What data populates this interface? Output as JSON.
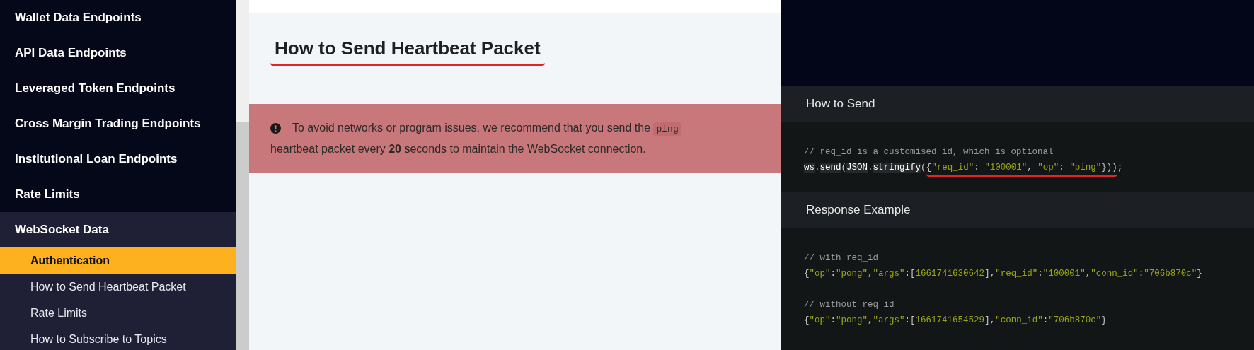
{
  "sidebar": {
    "items": [
      {
        "label": "Wallet Data Endpoints",
        "expanded": false
      },
      {
        "label": "API Data Endpoints",
        "expanded": false
      },
      {
        "label": "Leveraged Token Endpoints",
        "expanded": false
      },
      {
        "label": "Cross Margin Trading Endpoints",
        "expanded": false
      },
      {
        "label": "Institutional Loan Endpoints",
        "expanded": false
      },
      {
        "label": "Rate Limits",
        "expanded": false
      },
      {
        "label": "WebSocket Data",
        "expanded": true,
        "children": [
          {
            "label": "Authentication",
            "selected": true
          },
          {
            "label": "How to Send Heartbeat Packet",
            "selected": false
          },
          {
            "label": "Rate Limits",
            "selected": false
          },
          {
            "label": "How to Subscribe to Topics",
            "selected": false
          }
        ]
      }
    ]
  },
  "main": {
    "heading": {
      "text": "How to Send Heartbeat Packet",
      "underlined": true
    },
    "alert": {
      "before": "To avoid networks or program issues, we recommend that you send the",
      "code": "ping",
      "after": "heartbeat packet every **20** seconds to maintain the WebSocket connection."
    }
  },
  "code_panel": {
    "sections": [
      {
        "title": "How to Send",
        "blocks": [
          [
            [
              {
                "text": "// req_id is a customised id, which is optional",
                "kind": "comment"
              }
            ],
            [
              {
                "text": "ws",
                "kind": "ident"
              },
              {
                "text": ".",
                "kind": "plain"
              },
              {
                "text": "send",
                "kind": "ident"
              },
              {
                "text": "(",
                "kind": "plain"
              },
              {
                "text": "JSON",
                "kind": "ident"
              },
              {
                "text": ".",
                "kind": "plain"
              },
              {
                "text": "stringify",
                "kind": "ident"
              },
              {
                "text": "(",
                "kind": "plain"
              },
              {
                "kind": "group",
                "underlined": true,
                "tokens": [
                  {
                    "text": "{",
                    "kind": "plain"
                  },
                  {
                    "text": "\"req_id\"",
                    "kind": "string"
                  },
                  {
                    "text": ": ",
                    "kind": "plain"
                  },
                  {
                    "text": "\"100001\"",
                    "kind": "string"
                  },
                  {
                    "text": ", ",
                    "kind": "plain"
                  },
                  {
                    "text": "\"op\"",
                    "kind": "string"
                  },
                  {
                    "text": ": ",
                    "kind": "plain"
                  },
                  {
                    "text": "\"ping\"",
                    "kind": "string"
                  },
                  {
                    "text": "}))",
                    "kind": "plain"
                  }
                ]
              },
              {
                "text": ";",
                "kind": "plain"
              }
            ]
          ]
        ]
      },
      {
        "title": "Response Example",
        "blocks": [
          [
            [
              {
                "text": "// with req_id",
                "kind": "comment"
              }
            ],
            [
              {
                "text": "{",
                "kind": "plain"
              },
              {
                "text": "\"op\"",
                "kind": "string"
              },
              {
                "text": ":",
                "kind": "plain"
              },
              {
                "text": "\"pong\"",
                "kind": "string"
              },
              {
                "text": ",",
                "kind": "plain"
              },
              {
                "text": "\"args\"",
                "kind": "string"
              },
              {
                "text": ":[",
                "kind": "plain"
              },
              {
                "text": "1661741630642",
                "kind": "string"
              },
              {
                "text": "],",
                "kind": "plain"
              },
              {
                "text": "\"req_id\"",
                "kind": "string"
              },
              {
                "text": ":",
                "kind": "plain"
              },
              {
                "text": "\"100001\"",
                "kind": "string"
              },
              {
                "text": ",",
                "kind": "plain"
              },
              {
                "text": "\"conn_id\"",
                "kind": "string"
              },
              {
                "text": ":",
                "kind": "plain"
              },
              {
                "text": "\"706b870c\"",
                "kind": "string"
              },
              {
                "text": "}",
                "kind": "plain"
              }
            ]
          ],
          [
            [
              {
                "text": "// without req_id",
                "kind": "comment"
              }
            ],
            [
              {
                "text": "{",
                "kind": "plain"
              },
              {
                "text": "\"op\"",
                "kind": "string"
              },
              {
                "text": ":",
                "kind": "plain"
              },
              {
                "text": "\"pong\"",
                "kind": "string"
              },
              {
                "text": ",",
                "kind": "plain"
              },
              {
                "text": "\"args\"",
                "kind": "string"
              },
              {
                "text": ":[",
                "kind": "plain"
              },
              {
                "text": "1661741654529",
                "kind": "string"
              },
              {
                "text": "],",
                "kind": "plain"
              },
              {
                "text": "\"conn_id\"",
                "kind": "string"
              },
              {
                "text": ":",
                "kind": "plain"
              },
              {
                "text": "\"706b870c\"",
                "kind": "string"
              },
              {
                "text": "}",
                "kind": "plain"
              }
            ]
          ]
        ]
      }
    ]
  }
}
